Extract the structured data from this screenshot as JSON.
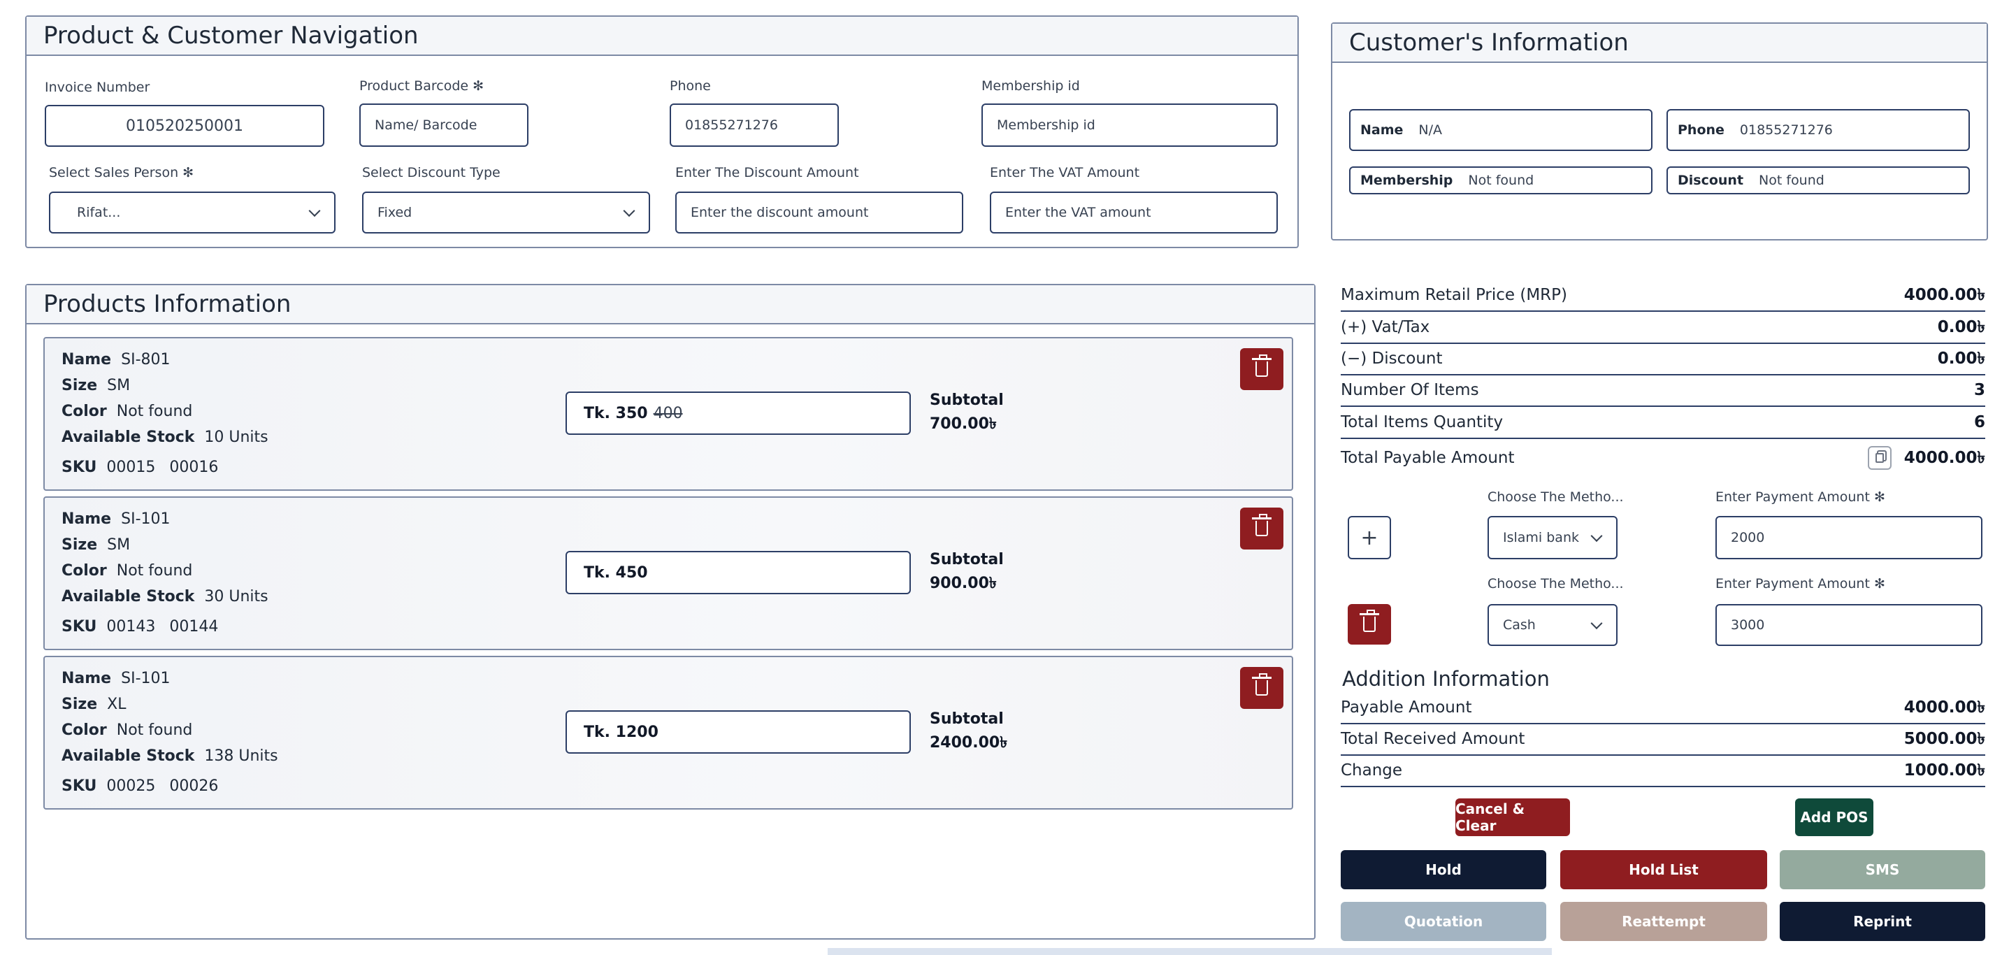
{
  "nav": {
    "title": "Product & Customer Navigation",
    "invoice_label": "Invoice Number",
    "invoice_value": "010520250001",
    "barcode_label": "Product Barcode ✻",
    "barcode_placeholder": "Name/ Barcode",
    "phone_label": "Phone",
    "phone_value": "01855271276",
    "membership_label": "Membership id",
    "membership_placeholder": "Membership id",
    "sales_person_label": "Select Sales Person ✻",
    "sales_person_value": "Rifat...",
    "discount_type_label": "Select Discount Type",
    "discount_type_value": "Fixed",
    "discount_amount_label": "Enter The Discount Amount",
    "discount_amount_placeholder": "Enter the discount amount",
    "vat_amount_label": "Enter The VAT Amount",
    "vat_amount_placeholder": "Enter the VAT amount"
  },
  "customer": {
    "title": "Customer's Information",
    "name_label": "Name",
    "name_value": "N/A",
    "phone_label": "Phone",
    "phone_value": "01855271276",
    "membership_label": "Membership",
    "membership_value": "Not found",
    "discount_label": "Discount",
    "discount_value": "Not found"
  },
  "products": {
    "title": "Products Information",
    "labels": {
      "name": "Name",
      "size": "Size",
      "color": "Color",
      "stock": "Available Stock",
      "sku": "SKU",
      "subtotal": "Subtotal"
    },
    "items": [
      {
        "name": "SI-801",
        "size": "SM",
        "color": "Not found",
        "stock": "10 Units",
        "sku1": "00015",
        "sku2": "00016",
        "price": "Tk. 350",
        "old_price": "400",
        "subtotal": "700.00৳"
      },
      {
        "name": "SI-101",
        "size": "SM",
        "color": "Not found",
        "stock": "30 Units",
        "sku1": "00143",
        "sku2": "00144",
        "price": "Tk. 450",
        "old_price": "",
        "subtotal": "900.00৳"
      },
      {
        "name": "SI-101",
        "size": "XL",
        "color": "Not found",
        "stock": "138 Units",
        "sku1": "00025",
        "sku2": "00026",
        "price": "Tk. 1200",
        "old_price": "",
        "subtotal": "2400.00৳"
      }
    ]
  },
  "summary": {
    "rows": [
      {
        "label": "Maximum Retail Price (MRP)",
        "value": "4000.00৳"
      },
      {
        "label": "(+) Vat/Tax",
        "value": "0.00৳"
      },
      {
        "label": "(−) Discount",
        "value": "0.00৳"
      },
      {
        "label": "Number Of Items",
        "value": "3"
      },
      {
        "label": "Total Items Quantity",
        "value": "6"
      }
    ],
    "payable_label": "Total Payable Amount",
    "payable_value": "4000.00৳"
  },
  "payment": {
    "method_label": "Choose The Metho...",
    "amount_label": "Enter Payment Amount ✻",
    "lines": [
      {
        "method": "Islami bank",
        "amount": "2000"
      },
      {
        "method": "Cash",
        "amount": "3000"
      }
    ]
  },
  "addition": {
    "title": "Addition Information",
    "rows": [
      {
        "label": "Payable Amount",
        "value": "4000.00৳"
      },
      {
        "label": "Total Received Amount",
        "value": "5000.00৳"
      },
      {
        "label": "Change",
        "value": "1000.00৳"
      }
    ]
  },
  "buttons": {
    "cancel": "Cancel & Clear",
    "add_pos": "Add POS",
    "hold": "Hold",
    "hold_list": "Hold List",
    "sms": "SMS",
    "quotation": "Quotation",
    "reattempt": "Reattempt",
    "reprint": "Reprint"
  },
  "colors": {
    "navy": "#0f1b33",
    "maroon": "#8f1d20",
    "green": "#0f4a3a",
    "sage": "#94aa9e",
    "slate": "#a3b4c2",
    "taupe": "#b8a198",
    "border": "#2c3e66"
  }
}
